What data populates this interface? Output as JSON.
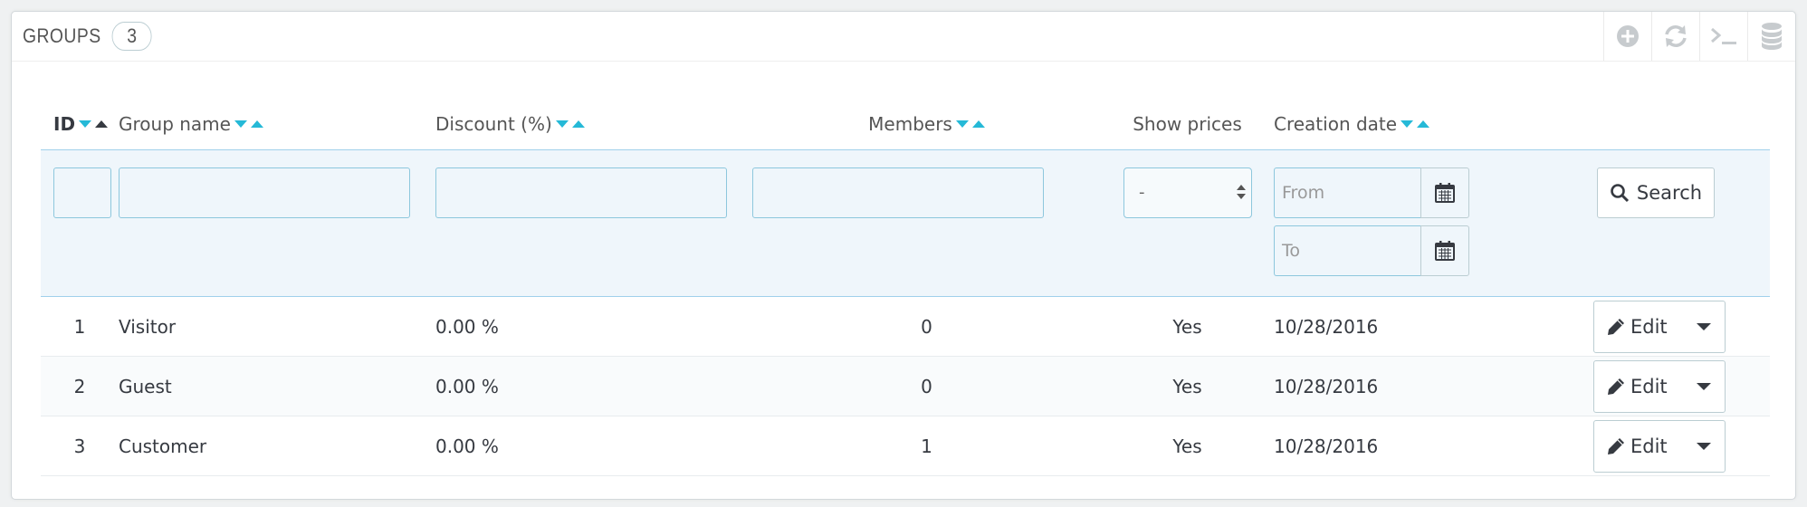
{
  "panel": {
    "title": "GROUPS",
    "count": "3",
    "toolbar": [
      {
        "name": "add-new-icon",
        "label": "Add new"
      },
      {
        "name": "refresh-icon",
        "label": "Refresh list"
      },
      {
        "name": "terminal-icon",
        "label": "Show SQL query"
      },
      {
        "name": "database-icon",
        "label": "Export to SQL Manager"
      }
    ]
  },
  "columns": {
    "id": "ID",
    "group_name": "Group name",
    "discount": "Discount (%)",
    "members": "Members",
    "show_prices": "Show prices",
    "creation_date": "Creation date"
  },
  "filters": {
    "id": "",
    "group_name": "",
    "discount": "",
    "members": "",
    "show_prices_selected": "-",
    "date_from_placeholder": "From",
    "date_to_placeholder": "To",
    "search_label": "Search"
  },
  "rows": [
    {
      "id": "1",
      "name": "Visitor",
      "discount": "0.00 %",
      "members": "0",
      "show_prices": "Yes",
      "created": "10/28/2016",
      "action": "Edit"
    },
    {
      "id": "2",
      "name": "Guest",
      "discount": "0.00 %",
      "members": "0",
      "show_prices": "Yes",
      "created": "10/28/2016",
      "action": "Edit"
    },
    {
      "id": "3",
      "name": "Customer",
      "discount": "0.00 %",
      "members": "1",
      "show_prices": "Yes",
      "created": "10/28/2016",
      "action": "Edit"
    }
  ],
  "colors": {
    "accent": "#25b9d7",
    "filter_background": "#eff6fb",
    "border": "#bbcdd2"
  }
}
